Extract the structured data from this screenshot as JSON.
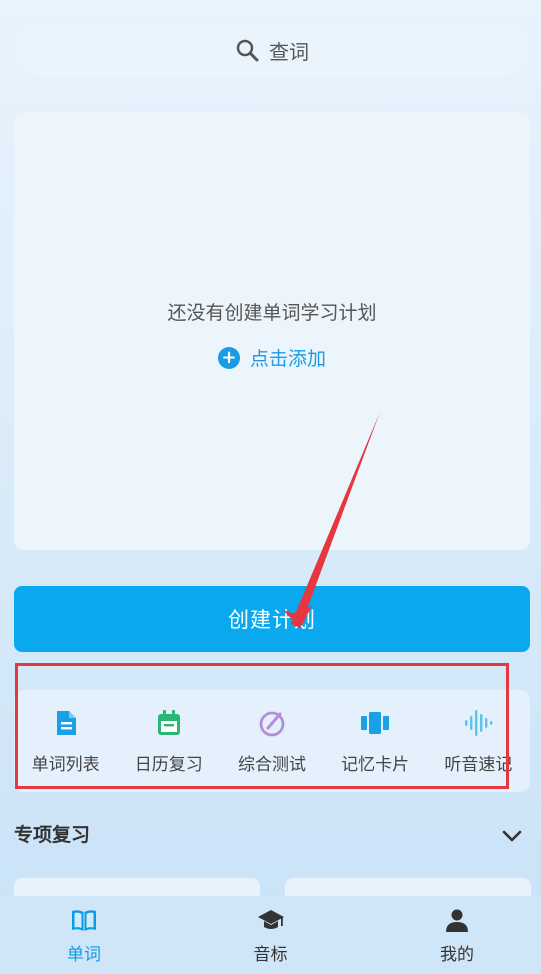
{
  "search": {
    "label": "查词",
    "icon": "search-icon"
  },
  "plan": {
    "empty_text": "还没有创建单词学习计划",
    "add_label": "点击添加",
    "add_icon": "plus-circle-icon"
  },
  "create_button": {
    "label": "创建计划"
  },
  "tools": [
    {
      "label": "单词列表",
      "icon": "document-list-icon",
      "color": "#1aa0e6"
    },
    {
      "label": "日历复习",
      "icon": "calendar-icon",
      "color": "#2bb673"
    },
    {
      "label": "综合测试",
      "icon": "compass-test-icon",
      "color": "#b38fd9"
    },
    {
      "label": "记忆卡片",
      "icon": "cards-icon",
      "color": "#1aa0e6"
    },
    {
      "label": "听音速记",
      "icon": "sound-wave-icon",
      "color": "#5cc2ee"
    }
  ],
  "section": {
    "title": "专项复习",
    "toggle_icon": "chevron-down-icon"
  },
  "tabbar": [
    {
      "label": "单词",
      "icon": "book-icon",
      "active": true
    },
    {
      "label": "音标",
      "icon": "graduation-cap-icon",
      "active": false
    },
    {
      "label": "我的",
      "icon": "user-icon",
      "active": false
    }
  ],
  "colors": {
    "accent": "#0aa8ee",
    "highlight": "#e5373f",
    "active_tab": "#0a9be6"
  }
}
